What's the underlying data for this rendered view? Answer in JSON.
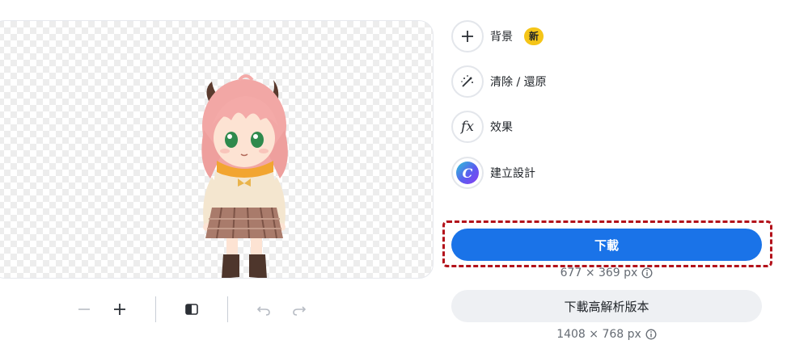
{
  "options": {
    "background": {
      "label": "背景",
      "badge": "新",
      "icon": "plus-icon"
    },
    "erase": {
      "label": "清除 / 還原",
      "icon": "magic-brush-icon"
    },
    "effects": {
      "label": "效果",
      "icon": "fx-icon",
      "icon_text": "fx"
    },
    "design": {
      "label": "建立設計",
      "icon": "canva-icon",
      "icon_text": "C"
    }
  },
  "download": {
    "button_label": "下載",
    "size_text": "677 × 369 px",
    "hd_button_label": "下載高解析版本",
    "hd_size_text": "1408 × 768 px",
    "primary_color": "#1a73e8",
    "highlight_color": "#b3121b"
  },
  "toolbar": {
    "icons": [
      "zoom-out-icon",
      "zoom-in-icon",
      "compare-icon",
      "undo-icon",
      "redo-icon"
    ]
  }
}
